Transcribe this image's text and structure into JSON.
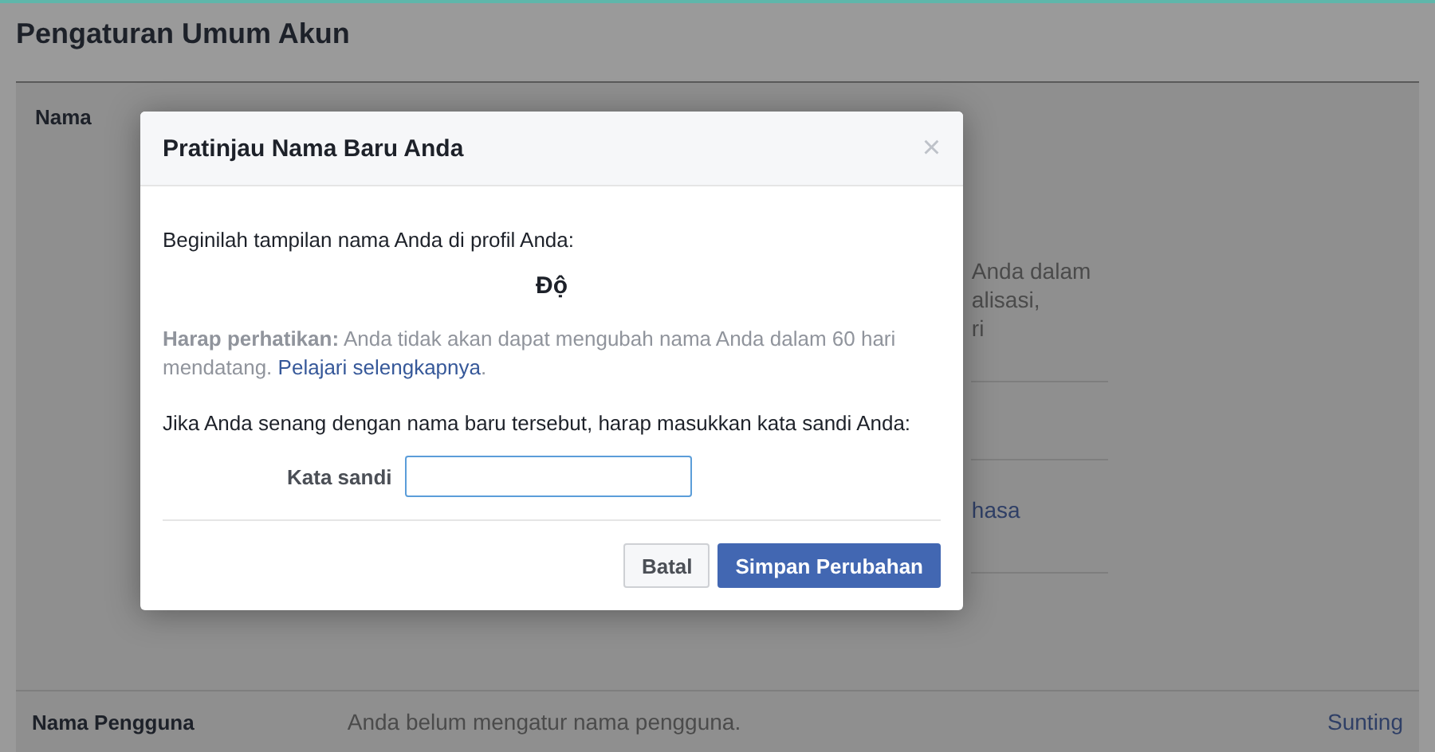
{
  "page": {
    "title": "Pengaturan Umum Akun"
  },
  "name_row": {
    "label": "Nama",
    "fragments": [
      {
        "text": "Anda dalam",
        "kind": "text"
      },
      {
        "text": "alisasi,",
        "kind": "text"
      },
      {
        "text": "ri",
        "kind": "text"
      },
      {
        "text": "hasa",
        "kind": "link"
      }
    ]
  },
  "username_row": {
    "label": "Nama Pengguna",
    "value": "Anda belum mengatur nama pengguna.",
    "action": "Sunting"
  },
  "dialog": {
    "title": "Pratinjau Nama Baru Anda",
    "close": "×",
    "intro": "Beginilah tampilan nama Anda di profil Anda:",
    "preview_name": "Độ",
    "notice": "**Harap perhatikan:** Anda tidak akan dapat mengubah nama Anda dalam 60 hari mendatang.",
    "notice_link": "Pelajari selengkapnya",
    "notice_end": ".",
    "prompt": "Jika Anda senang dengan nama baru tersebut, harap masukkan kata sandi Anda:",
    "password_label": "Kata sandi",
    "buttons": [
      {
        "label": "Batal",
        "kind": "secondary"
      },
      {
        "label": "Simpan Perubahan",
        "kind": "primary"
      }
    ]
  }
}
